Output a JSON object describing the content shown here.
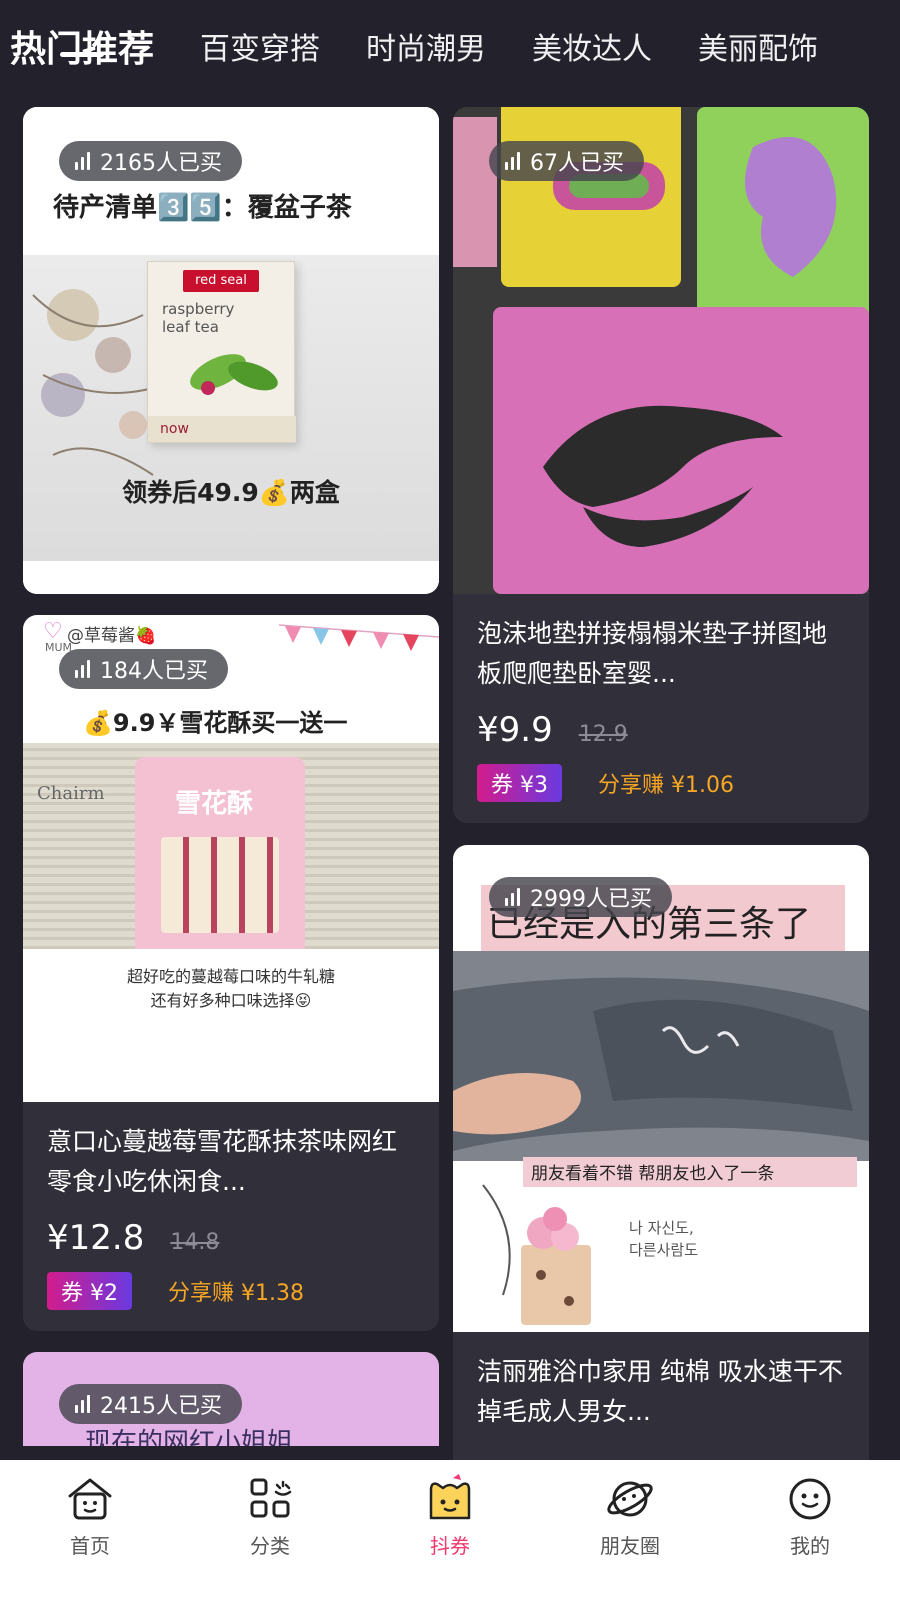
{
  "tabs": [
    {
      "label": "热门推荐",
      "active": true
    },
    {
      "label": "百变穿搭",
      "active": false
    },
    {
      "label": "时尚潮男",
      "active": false
    },
    {
      "label": "美妆达人",
      "active": false
    },
    {
      "label": "美丽配饰",
      "active": false
    }
  ],
  "products": [
    {
      "sold": "2165人已买",
      "banner": "待产清单3️⃣5️⃣：覆盆子茶",
      "box_brand": "red seal",
      "box_text": "raspberry leaf tea",
      "box_sub": "now",
      "caption": "领券后49.9💰两盒"
    },
    {
      "sold": "67人已买",
      "title": "泡沫地垫拼接榻榻米垫子拼图地板爬爬垫卧室婴...",
      "price": "¥9.9",
      "original_price": "12.9",
      "coupon": "券 ¥3",
      "share": "分享赚 ¥1.06"
    },
    {
      "sold": "184人已买",
      "handle": "@草莓酱🍓",
      "mum": "MUM",
      "banner": "💰9.9￥雪花酥买一送一",
      "pack_text": "雪花酥",
      "news_text": "Chairm",
      "caption_line1": "超好吃的蔓越莓口味的牛轧糖",
      "caption_line2": "还有好多种口味选择😝",
      "title": "意口心蔓越莓雪花酥抹茶味网红零食小吃休闲食...",
      "price": "¥12.8",
      "original_price": "14.8",
      "coupon": "券 ¥2",
      "share": "分享赚 ¥1.38"
    },
    {
      "sold": "2999人已买",
      "banner": "已经是入的第三条了",
      "caption": "朋友看着不错 帮朋友也入了一条",
      "korean_line1": "나 자신도,",
      "korean_line2": "다른사람도",
      "title": "洁丽雅浴巾家用 纯棉 吸水速干不掉毛成人男女..."
    },
    {
      "sold": "2415人已买",
      "banner": "现在的网红小姐姐"
    }
  ],
  "bottom_nav": [
    {
      "label": "首页",
      "icon": "home-icon",
      "active": false
    },
    {
      "label": "分类",
      "icon": "category-icon",
      "active": false
    },
    {
      "label": "抖券",
      "icon": "doucoupon-icon",
      "active": true
    },
    {
      "label": "朋友圈",
      "icon": "planet-icon",
      "active": false
    },
    {
      "label": "我的",
      "icon": "smile-face-icon",
      "active": false
    }
  ],
  "colors": {
    "background": "#23222c",
    "card": "#31303a",
    "share_text": "#f6a623",
    "active_nav": "#ef3a6e",
    "coupon_gradient_start": "#d21c8c",
    "coupon_gradient_end": "#6a3ae0"
  }
}
